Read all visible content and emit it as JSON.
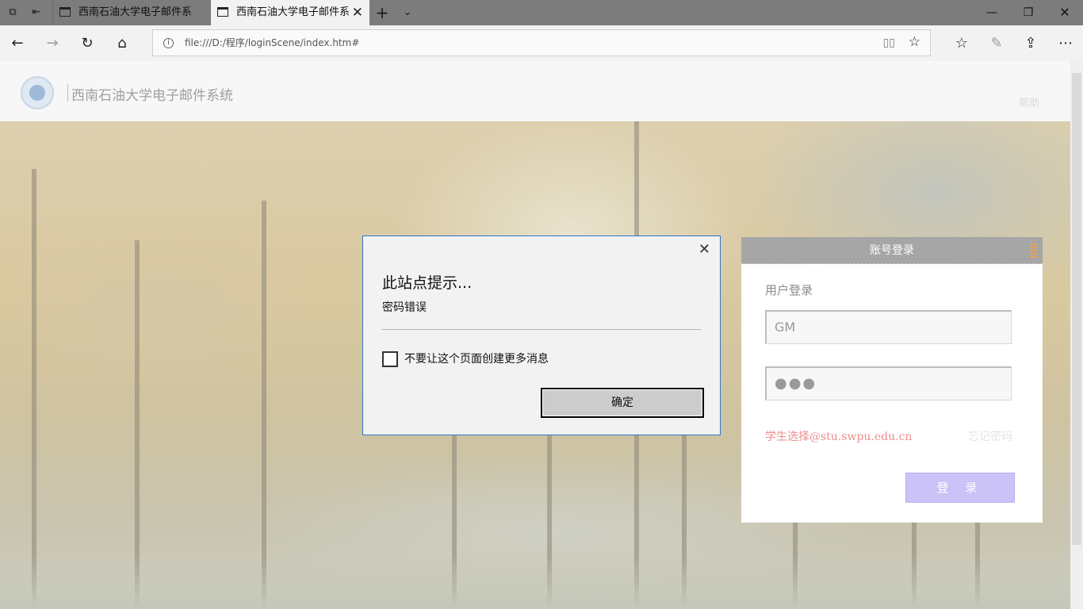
{
  "browser": {
    "tabs": [
      {
        "title": "西南石油大学电子邮件系统"
      },
      {
        "title": "西南石油大学电子邮件系"
      }
    ],
    "address": {
      "url": "file:///D:/程序/loginScene/index.htm#"
    }
  },
  "page": {
    "site_title": "西南石油大学电子邮件系统",
    "help_link": "帮助",
    "login": {
      "header": "账号登录",
      "section_title": "用户登录",
      "username_value": "GM",
      "password_mask": "●●●",
      "student_hint": "学生选择@stu.swpu.edu.cn",
      "forgot_link": "忘记密码",
      "submit_label": "登 录"
    }
  },
  "dialog": {
    "title": "此站点提示...",
    "message": "密码错误",
    "checkbox_label": "不要让这个页面创建更多消息",
    "ok_label": "确定"
  }
}
